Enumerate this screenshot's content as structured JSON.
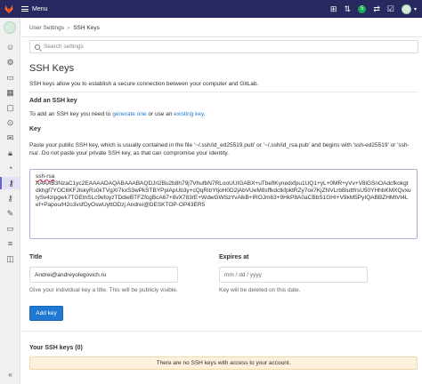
{
  "topbar": {
    "menu_label": "Menu",
    "badge_count": "5"
  },
  "breadcrumb": {
    "parent": "User Settings",
    "separator": "›",
    "current": "SSH Keys"
  },
  "search": {
    "placeholder": "Search settings"
  },
  "page": {
    "title": "SSH Keys",
    "lead": "SSH keys allow you to establish a secure connection between your computer and GitLab."
  },
  "add_key": {
    "heading": "Add an SSH key",
    "intro_prefix": "To add an SSH key you need to ",
    "generate_link": "generate one",
    "intro_middle": " or use an ",
    "existing_link": "existing key",
    "intro_suffix": ".",
    "key_label": "Key",
    "key_help": "Paste your public SSH key, which is usually contained in the file '~/.ssh/id_ed25519.pub' or '~/.ssh/id_rsa.pub' and begins with 'ssh-ed25519' or 'ssh-rsa'. Do not paste your private SSH key, as that can compromise your identity.",
    "key_value_prefix": "ssh-rsa",
    "key_value": "AAAAB3NzaC1yc2EAAAADAQABAAABAQDJrl2Bu2b8h79j7VhufbN7RLooUUIGABX+uTbeflKynedxfpu1UQ1+yL+0MR+yVv+V8iGSnOAdcfkokgtdkhgf7YOC6KFJlskyRs0kTVgXI7kxS3wPkSTBYPplApUb3y+cQqRitrYtjoH0D2jAbVUeM8sffkdctkfpktRZy7ox7KjZNVLrbBiuttfrsU50YHhbKMXQvxulySv4zipgwk7TGEtnSLc9efoyzTDdieBTFZfcgBcA67+8vX783rE+WdwGWSzYvAlkB+lROJm63+9HkP8A0aCBbS1GHI+V9kM5PyIQABBZHMtVt4Lef+Papou/H2o3vsfOyOswUyttODzj Andrei@DESKTOP-OP43ER5",
    "title_label": "Title",
    "title_value": "Andrei@andreyolegovich.ru",
    "title_help": "Give your individual key a title. This will be publicly visible.",
    "expires_label": "Expires at",
    "expires_placeholder": "mm / dd / yyyy",
    "expires_help": "Key will be deleted on this date.",
    "submit_label": "Add key"
  },
  "your_keys": {
    "heading": "Your SSH keys (0)",
    "empty_notice": "There are no SSH keys with access to your account."
  },
  "colors": {
    "topbar": "#292961",
    "link": "#1f78d1",
    "primary_button": "#1f78d1",
    "notice_bg": "#fdf1dd",
    "badge": "#1aaa55"
  },
  "icons": {
    "topbar": [
      "gitlab-logo-icon",
      "hamburger-icon",
      "plus-square-icon",
      "merge-request-icon",
      "issues-icon",
      "todo-icon",
      "user-avatar-icon"
    ],
    "sidebar": [
      "user-avatar-icon",
      "profile-icon",
      "account-icon",
      "billing-icon",
      "applications-icon",
      "chat-icon",
      "access-tokens-icon",
      "emails-icon",
      "password-icon",
      "notifications-icon",
      "ssh-key-icon",
      "gpg-key-icon",
      "preferences-icon",
      "active-sessions-icon",
      "authentication-log-icon",
      "usage-quotas-icon",
      "collapse-icon"
    ]
  }
}
